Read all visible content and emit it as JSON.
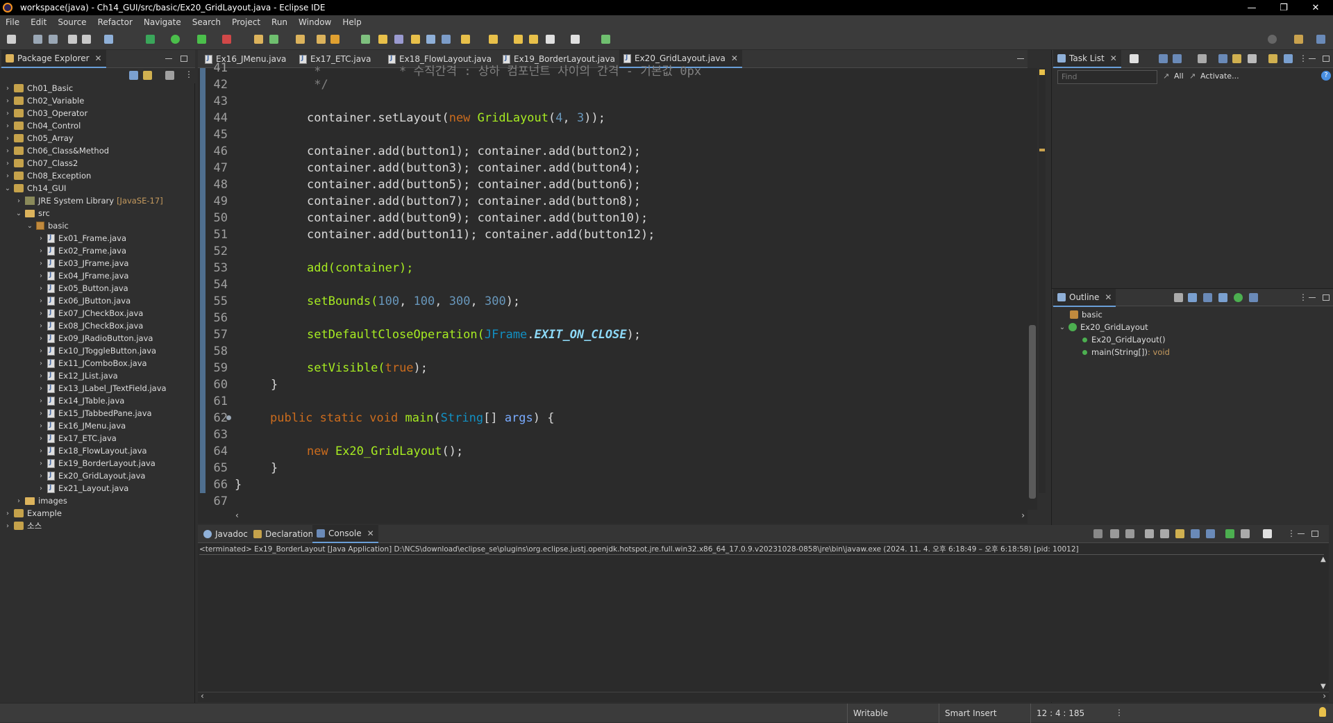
{
  "window": {
    "title": "workspace(java) - Ch14_GUI/src/basic/Ex20_GridLayout.java - Eclipse IDE"
  },
  "menu": [
    "File",
    "Edit",
    "Source",
    "Refactor",
    "Navigate",
    "Search",
    "Project",
    "Run",
    "Window",
    "Help"
  ],
  "package_explorer": {
    "title": "Package Explorer",
    "projects": [
      "Ch01_Basic",
      "Ch02_Variable",
      "Ch03_Operator",
      "Ch04_Control",
      "Ch05_Array",
      "Ch06_Class&Method",
      "Ch07_Class2",
      "Ch08_Exception",
      "Ch14_GUI"
    ],
    "jre": {
      "label": "JRE System Library",
      "decor": "[JavaSE-17]"
    },
    "src": "src",
    "package": "basic",
    "files": [
      "Ex01_Frame.java",
      "Ex02_Frame.java",
      "Ex03_JFrame.java",
      "Ex04_JFrame.java",
      "Ex05_Button.java",
      "Ex06_JButton.java",
      "Ex07_JCheckBox.java",
      "Ex08_JCheckBox.java",
      "Ex09_JRadioButton.java",
      "Ex10_JToggleButton.java",
      "Ex11_JComboBox.java",
      "Ex12_JList.java",
      "Ex13_JLabel_JTextField.java",
      "Ex14_JTable.java",
      "Ex15_JTabbedPane.java",
      "Ex16_JMenu.java",
      "Ex17_ETC.java",
      "Ex18_FlowLayout.java",
      "Ex19_BorderLayout.java",
      "Ex20_GridLayout.java",
      "Ex21_Layout.java"
    ],
    "images": "images",
    "others": [
      "Example",
      "소스"
    ]
  },
  "editor_tabs": [
    "Ex16_JMenu.java",
    "Ex17_ETC.java",
    "Ex18_FlowLayout.java",
    "Ex19_BorderLayout.java",
    "Ex20_GridLayout.java"
  ],
  "active_editor_tab": "Ex20_GridLayout.java",
  "code": {
    "line_numbers": [
      "41",
      "42",
      "43",
      "44",
      "45",
      "46",
      "47",
      "48",
      "49",
      "50",
      "51",
      "52",
      "53",
      "54",
      "55",
      "56",
      "57",
      "58",
      "59",
      "60",
      "61",
      "62",
      "63",
      "64",
      "65",
      "66",
      "67"
    ],
    "l41": " *           * 수직간격 : 상하 컴포넌트 사이의 간격 - 기본값 0px",
    "l42": " */",
    "l44a": "container.setLayout(",
    "l44b": "new",
    "l44c": " GridLayout",
    "l44d": "(",
    "l44e": "4",
    "l44f": ", ",
    "l44g": "3",
    "l44h": "));",
    "l46": "container.add(button1); container.add(button2);",
    "l47": "container.add(button3); container.add(button4);",
    "l48": "container.add(button5); container.add(button6);",
    "l49": "container.add(button7); container.add(button8);",
    "l50": "container.add(button9); container.add(button10);",
    "l51": "container.add(button11); container.add(button12);",
    "l53": "add(container);",
    "l55a": "setBounds(",
    "l55b": "100",
    "l55c": ", ",
    "l55d": "100",
    "l55e": ", ",
    "l55f": "300",
    "l55g": ", ",
    "l55h": "300",
    "l55i": ");",
    "l57a": "setDefaultCloseOperation(",
    "l57b": "JFrame",
    "l57c": ".",
    "l57d": "EXIT_ON_CLOSE",
    "l57e": ");",
    "l59a": "setVisible(",
    "l59b": "true",
    "l59c": ");",
    "l60": "}",
    "l62a": "public static void",
    "l62b": " main",
    "l62c": "(",
    "l62d": "String",
    "l62e": "[] ",
    "l62f": "args",
    "l62g": ") {",
    "l64a": "new",
    "l64b": " Ex20_GridLayout",
    "l64c": "();",
    "l65": "}",
    "l66": "}"
  },
  "task_list": {
    "title": "Task List",
    "find_placeholder": "Find",
    "all": "All",
    "activate": "Activate..."
  },
  "outline": {
    "title": "Outline",
    "package": "basic",
    "class": "Ex20_GridLayout",
    "constructor": "Ex20_GridLayout()",
    "method": "main(String[])",
    "method_type": " : void"
  },
  "bottom_tabs": [
    "Javadoc",
    "Declaration",
    "Console"
  ],
  "active_bottom_tab": "Console",
  "console": {
    "status_line": "<terminated> Ex19_BorderLayout [Java Application] D:\\NCS\\download\\eclipse_se\\plugins\\org.eclipse.justj.openjdk.hotspot.jre.full.win32.x86_64_17.0.9.v20231028-0858\\jre\\bin\\javaw.exe  (2024. 11. 4. 오후 6:18:49 – 오후 6:18:58) [pid: 10012]"
  },
  "status": {
    "writable": "Writable",
    "insert": "Smart Insert",
    "position": "12 : 4 : 185"
  },
  "colors": {
    "accent": "#6a9fd8",
    "keyword": "#cc6c1d",
    "method": "#a7ec21",
    "number": "#6897bb",
    "type": "#1290c3"
  }
}
